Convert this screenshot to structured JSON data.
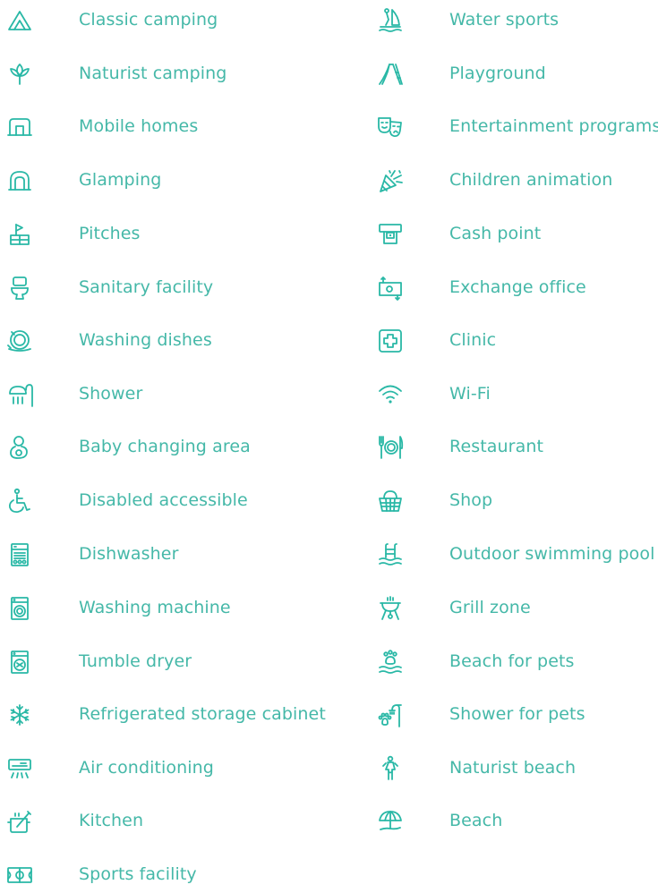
{
  "colors": {
    "accent": "#29b8a6",
    "text": "#45b8a8",
    "background": "#ffffff"
  },
  "left_column": [
    {
      "label": "Classic camping",
      "icon": "tent-icon"
    },
    {
      "label": "Naturist camping",
      "icon": "leaf-icon"
    },
    {
      "label": "Mobile homes",
      "icon": "mobile-home-icon"
    },
    {
      "label": "Glamping",
      "icon": "glamping-icon"
    },
    {
      "label": "Pitches",
      "icon": "pitch-flag-icon"
    },
    {
      "label": "Sanitary facility",
      "icon": "toilet-icon"
    },
    {
      "label": "Washing dishes",
      "icon": "dishes-icon"
    },
    {
      "label": "Shower",
      "icon": "shower-icon"
    },
    {
      "label": "Baby changing area",
      "icon": "baby-icon"
    },
    {
      "label": "Disabled accessible",
      "icon": "wheelchair-icon"
    },
    {
      "label": "Dishwasher",
      "icon": "dishwasher-icon"
    },
    {
      "label": "Washing machine",
      "icon": "washing-machine-icon"
    },
    {
      "label": "Tumble dryer",
      "icon": "tumble-dryer-icon"
    },
    {
      "label": "Refrigerated storage cabinet",
      "icon": "snowflake-icon"
    },
    {
      "label": "Air conditioning",
      "icon": "air-conditioning-icon"
    },
    {
      "label": "Kitchen",
      "icon": "kitchen-icon"
    },
    {
      "label": "Sports facility",
      "icon": "sports-field-icon"
    }
  ],
  "right_column": [
    {
      "label": "Water sports",
      "icon": "windsurf-icon"
    },
    {
      "label": "Playground",
      "icon": "slide-icon"
    },
    {
      "label": "Entertainment programs",
      "icon": "theater-masks-icon"
    },
    {
      "label": "Children animation",
      "icon": "party-popper-icon"
    },
    {
      "label": "Cash point",
      "icon": "atm-icon"
    },
    {
      "label": "Exchange office",
      "icon": "exchange-icon"
    },
    {
      "label": "Clinic",
      "icon": "medical-cross-icon"
    },
    {
      "label": "Wi-Fi",
      "icon": "wifi-icon"
    },
    {
      "label": "Restaurant",
      "icon": "restaurant-icon"
    },
    {
      "label": "Shop",
      "icon": "basket-icon"
    },
    {
      "label": "Outdoor swimming pool",
      "icon": "pool-icon"
    },
    {
      "label": "Grill zone",
      "icon": "grill-icon"
    },
    {
      "label": "Beach for pets",
      "icon": "pet-beach-icon"
    },
    {
      "label": "Shower for pets",
      "icon": "pet-shower-icon"
    },
    {
      "label": "Naturist beach",
      "icon": "naturist-icon"
    },
    {
      "label": "Beach",
      "icon": "umbrella-icon"
    }
  ]
}
